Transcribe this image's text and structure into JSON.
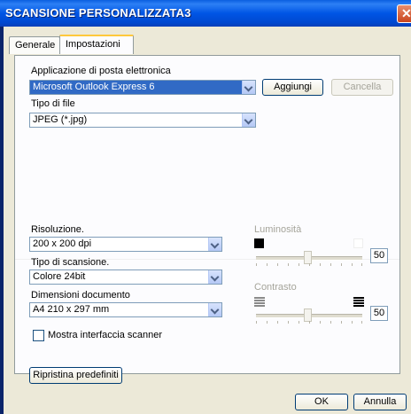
{
  "window": {
    "title": "SCANSIONE PERSONALIZZATA3"
  },
  "tabs": [
    {
      "label": "Generale",
      "active": false
    },
    {
      "label": "Impostazioni",
      "active": true
    }
  ],
  "email": {
    "label": "Applicazione di posta elettronica",
    "value": "Microsoft Outlook Express 6",
    "add_label": "Aggiungi",
    "delete_label": "Cancella"
  },
  "filetype": {
    "label": "Tipo di file",
    "value": "JPEG (*.jpg)"
  },
  "resolution": {
    "label": "Risoluzione.",
    "value": "200 x 200 dpi"
  },
  "scantype": {
    "label": "Tipo di scansione.",
    "value": "Colore 24bit"
  },
  "docsize": {
    "label": "Dimensioni documento",
    "value": "A4 210 x 297 mm"
  },
  "show_scanner": {
    "label": "Mostra interfaccia scanner",
    "checked": false
  },
  "brightness": {
    "label": "Luminosità",
    "value": "50"
  },
  "contrast": {
    "label": "Contrasto",
    "value": "50"
  },
  "buttons": {
    "restore": "Ripristina predefiniti",
    "ok": "OK",
    "cancel": "Annulla"
  }
}
